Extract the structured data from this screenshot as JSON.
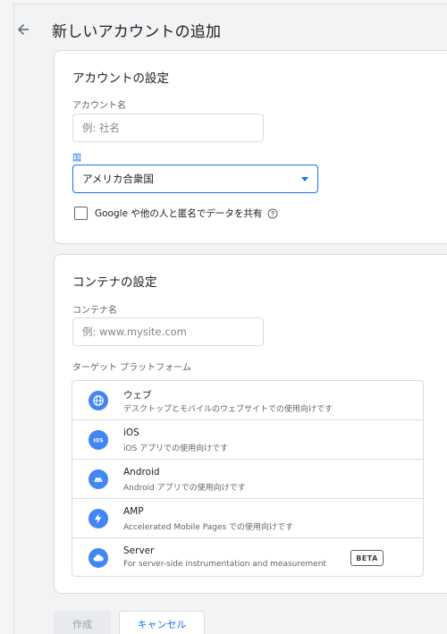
{
  "header": {
    "title": "新しいアカウントの追加"
  },
  "account_section": {
    "title": "アカウントの設定",
    "name_label": "アカウント名",
    "name_placeholder": "例: 社名",
    "country_label": "国",
    "country_value": "アメリカ合衆国",
    "share_label": "Google や他の人と匿名でデータを共有"
  },
  "container_section": {
    "title": "コンテナの設定",
    "name_label": "コンテナ名",
    "name_placeholder": "例: www.mysite.com",
    "platform_label": "ターゲット プラットフォーム",
    "platforms": [
      {
        "name": "ウェブ",
        "description": "デスクトップとモバイルのウェブサイトでの使用向けです",
        "icon": "globe-icon"
      },
      {
        "name": "iOS",
        "description": "iOS アプリでの使用向けです",
        "icon": "ios-icon"
      },
      {
        "name": "Android",
        "description": "Android アプリでの使用向けです",
        "icon": "android-icon"
      },
      {
        "name": "AMP",
        "description": "Accelerated Mobile Pages での使用向けです",
        "icon": "lightning-icon"
      },
      {
        "name": "Server",
        "description": "For server-side instrumentation and measurement",
        "icon": "cloud-icon",
        "badge": "BETA"
      }
    ]
  },
  "actions": {
    "create_label": "作成",
    "cancel_label": "キャンセル"
  },
  "colors": {
    "accent": "#1a73e8",
    "icon_bg": "#4285f4"
  }
}
